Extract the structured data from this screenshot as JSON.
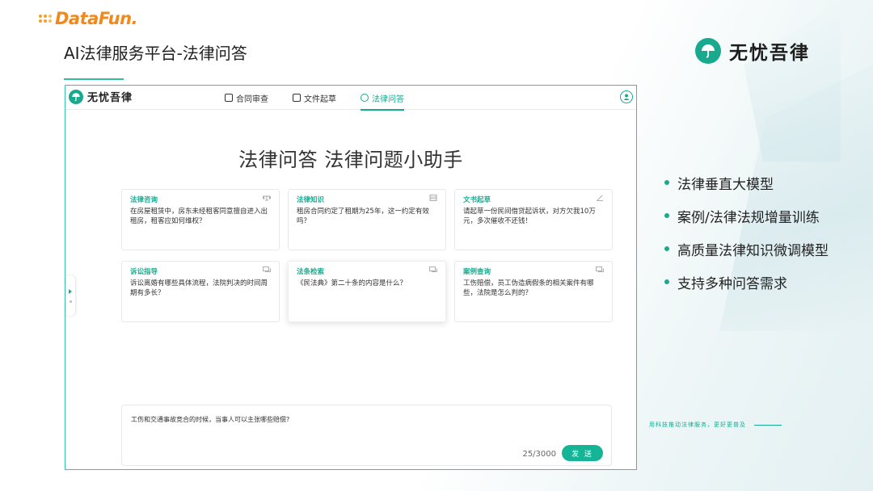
{
  "brand": {
    "name": "DataFun."
  },
  "slide": {
    "title": "AI法律服务平台-法律问答"
  },
  "top_logo": {
    "text": "无忧吾律"
  },
  "app": {
    "logo_text": "无忧吾律",
    "nav": [
      {
        "label": "合同审查",
        "active": false
      },
      {
        "label": "文件起草",
        "active": false
      },
      {
        "label": "法律问答",
        "active": true
      }
    ],
    "hero_title": "法律问答 法律问题小助手",
    "cards": [
      {
        "title": "法律咨询",
        "text": "在房屋租赁中，房东未经租客同意擅自进入出租房，租客应如何维权？",
        "icon": "scale-icon"
      },
      {
        "title": "法律知识",
        "text": "租房合同约定了租期为25年，这一约定有效吗？",
        "icon": "book-icon"
      },
      {
        "title": "文书起草",
        "text": "请起草一份民间借贷起诉状，对方欠我10万元，多次催收不还钱！",
        "icon": "pen-icon"
      },
      {
        "title": "诉讼指导",
        "text": "诉讼离婚有哪些具体流程，法院判决的时间周期有多长？",
        "icon": "chat-icon"
      },
      {
        "title": "法条检索",
        "text": "《民法典》第二十条的内容是什么？",
        "icon": "chat-icon"
      },
      {
        "title": "案例查询",
        "text": "工伤赔偿，员工伪造病假条的相关案件有哪些，法院是怎么判的？",
        "icon": "chat-icon"
      }
    ],
    "input": {
      "value": "工伤和交通事故竞合的时候，当事人可以主张哪些赔偿?",
      "char_count": "25/3000",
      "send_label": "发 送"
    }
  },
  "bullets": [
    "法律垂直大模型",
    "案例/法律法规增量训练",
    "高质量法律知识微调模型",
    "支持多种问答需求"
  ],
  "slogan": "用科技推动法律服务，更好更普及",
  "colors": {
    "accent": "#19a98e",
    "brand_orange": "#f08a1c"
  }
}
